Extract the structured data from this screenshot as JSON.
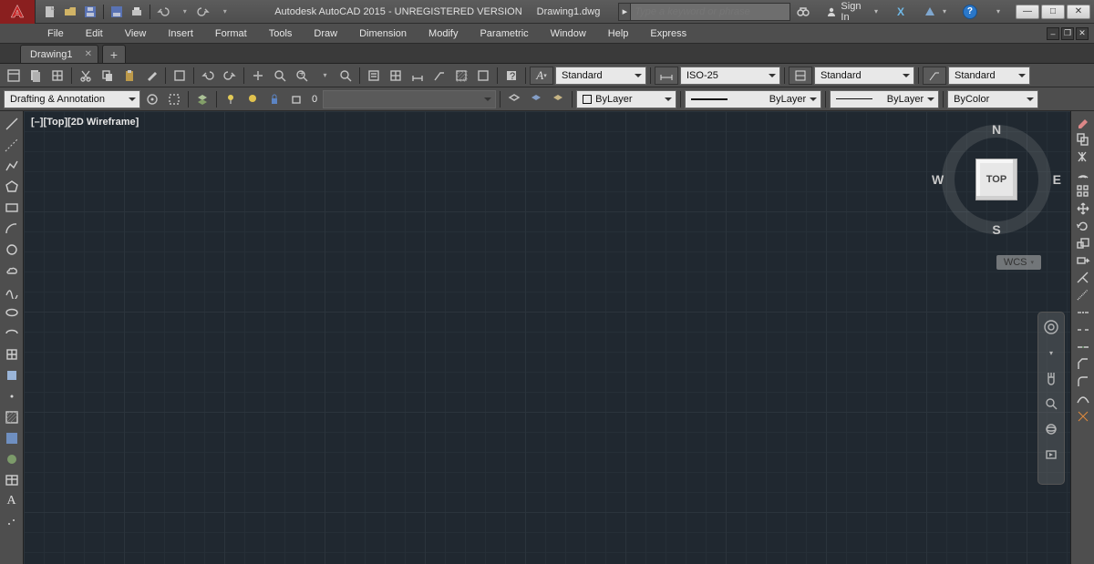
{
  "title": {
    "app": "Autodesk AutoCAD 2015 - UNREGISTERED VERSION",
    "doc": "Drawing1.dwg",
    "search_placeholder": "Type a keyword or phrase",
    "sign_in": "Sign In"
  },
  "menu": [
    "File",
    "Edit",
    "View",
    "Insert",
    "Format",
    "Tools",
    "Draw",
    "Dimension",
    "Modify",
    "Parametric",
    "Window",
    "Help",
    "Express"
  ],
  "file_tab": "Drawing1",
  "toolbar1": {
    "text_style": "Standard",
    "dim_style": "ISO-25",
    "table_style": "Standard",
    "mleader_style": "Standard"
  },
  "toolbar2": {
    "workspace": "Drafting & Annotation",
    "lock_val": "0",
    "layer": "ByLayer",
    "linetype": "ByLayer",
    "lineweight": "ByLayer",
    "plotcolor": "ByColor",
    "current_layer": "0"
  },
  "viewport": {
    "label": "[–][Top][2D Wireframe]",
    "cube_face": "TOP",
    "n": "N",
    "s": "S",
    "e": "E",
    "w": "W",
    "wcs": "WCS"
  }
}
